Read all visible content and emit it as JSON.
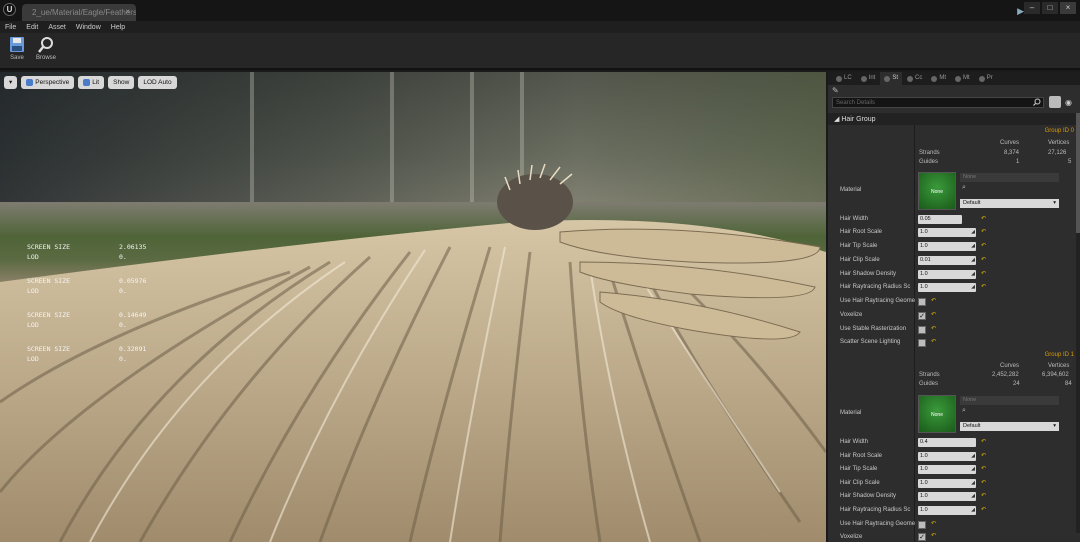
{
  "window": {
    "tab_title": "2_ue/Material/Eagle/Feathers",
    "tab_close": "×",
    "logo": "U",
    "controls": [
      "–",
      "□",
      "×"
    ],
    "flag": "▶"
  },
  "menu": [
    "File",
    "Edit",
    "Asset",
    "Window",
    "Help"
  ],
  "toolbar": {
    "save": "Save",
    "browse": "Browse"
  },
  "viewport": {
    "buttons": {
      "perspective": "Perspective",
      "lit": "Lit",
      "show": "Show",
      "lod": "LOD Auto"
    },
    "stats": [
      {
        "label": "SCREEN SIZE",
        "value": "2.06135",
        "lod_label": "LOD",
        "lod": "0."
      },
      {
        "label": "SCREEN SIZE",
        "value": "0.05976",
        "lod_label": "LOD",
        "lod": "0."
      },
      {
        "label": "SCREEN SIZE",
        "value": "0.14649",
        "lod_label": "LOD",
        "lod": "0."
      },
      {
        "label": "SCREEN SIZE",
        "value": "0.32091",
        "lod_label": "LOD",
        "lod": "0."
      }
    ]
  },
  "panel": {
    "tabs": [
      "LC",
      "Int",
      "St",
      "Cc",
      "Mt",
      "Mt",
      "Pr"
    ],
    "search_placeholder": "Search Details",
    "section": "Hair Group",
    "groups": [
      {
        "id_label": "Group ID 0",
        "curves_header": "Curves",
        "vertices_header": "Vertices",
        "strands_label": "Strands",
        "strands_curves": "8,374",
        "strands_vertices": "27,126",
        "guides_label": "Guides",
        "guides_curves": "1",
        "guides_vertices": "5",
        "material_label": "Material",
        "material_thumb": "None",
        "material_none": "None",
        "material_default": "Default",
        "hair_width_label": "Hair Width",
        "hair_width": "0.05",
        "root_scale_label": "Hair Root Scale",
        "root_scale": "1.0",
        "tip_scale_label": "Hair Tip Scale",
        "tip_scale": "1.0",
        "clip_scale_label": "Hair Clip Scale",
        "clip_scale": "0.01",
        "shadow_label": "Hair Shadow Density",
        "shadow": "1.0",
        "raytracing_label": "Hair Raytracing Radius Sc",
        "raytracing": "1.0",
        "use_rt_label": "Use Hair Raytracing Geome",
        "voxelize_label": "Voxelize",
        "stable_label": "Use Stable Rasterization",
        "scatter_label": "Scatter Scene Lighting"
      },
      {
        "id_label": "Group ID 1",
        "curves_header": "Curves",
        "vertices_header": "Vertices",
        "strands_label": "Strands",
        "strands_curves": "2,452,282",
        "strands_vertices": "6,394,602",
        "guides_label": "Guides",
        "guides_curves": "24",
        "guides_vertices": "84",
        "material_label": "Material",
        "material_thumb": "None",
        "material_none": "None",
        "material_default": "Default",
        "hair_width_label": "Hair Width",
        "hair_width": "0.4",
        "root_scale_label": "Hair Root Scale",
        "root_scale": "1.0",
        "tip_scale_label": "Hair Tip Scale",
        "tip_scale": "1.0",
        "clip_scale_label": "Hair Clip Scale",
        "clip_scale": "1.0",
        "shadow_label": "Hair Shadow Density",
        "shadow": "1.0",
        "raytracing_label": "Hair Raytracing Radius Sc",
        "raytracing": "1.0",
        "use_rt_label": "Use Hair Raytracing Geome",
        "voxelize_label": "Voxelize"
      }
    ]
  },
  "colors": {
    "accent": "#d89a00",
    "reset_arrow": "#d8b400",
    "material_green": "#2f8a2f"
  }
}
